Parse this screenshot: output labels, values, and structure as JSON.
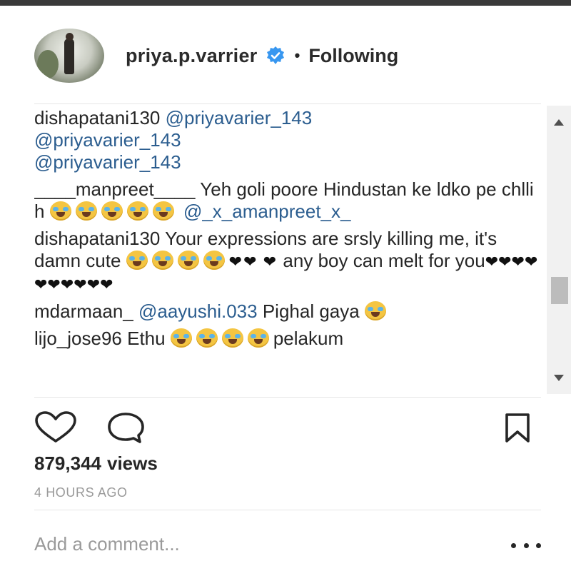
{
  "header": {
    "username": "priya.p.varrier",
    "separator": "•",
    "follow_status": "Following"
  },
  "comments": [
    {
      "user": "dishapatani130",
      "parts": [
        "@priyavarier_143",
        "@priyavarier_143",
        "@priyavarier_143"
      ]
    },
    {
      "user": "____manpreet____",
      "text": "Yeh goli poore Hindustan ke ldko pe chlli h",
      "mention": "@_x_amanpreet_x_"
    },
    {
      "user": "dishapatani130",
      "text_a": "Your expressions are srsly killing me, it's damn cute",
      "text_b": "any boy can melt for you"
    },
    {
      "user": "mdarmaan_",
      "mention": "@aayushi.033",
      "text": "Pighal gaya"
    },
    {
      "user": "lijo_jose96",
      "text": "Ethu",
      "text_end": "pelakum"
    }
  ],
  "stats": {
    "views_count": "879,344",
    "views_label": "views",
    "timestamp": "4 HOURS AGO"
  },
  "footer": {
    "add_comment_placeholder": "Add a comment..."
  },
  "icons": {
    "verified": "verified-badge-icon",
    "like": "heart-outline-icon",
    "comment": "speech-bubble-icon",
    "save": "bookmark-icon",
    "more": "ellipsis-icon",
    "scroll_up": "triangle-up-icon",
    "scroll_down": "triangle-down-icon"
  },
  "colors": {
    "mention": "#2b5d8f",
    "verified": "#3897f0",
    "muted": "#999999"
  }
}
